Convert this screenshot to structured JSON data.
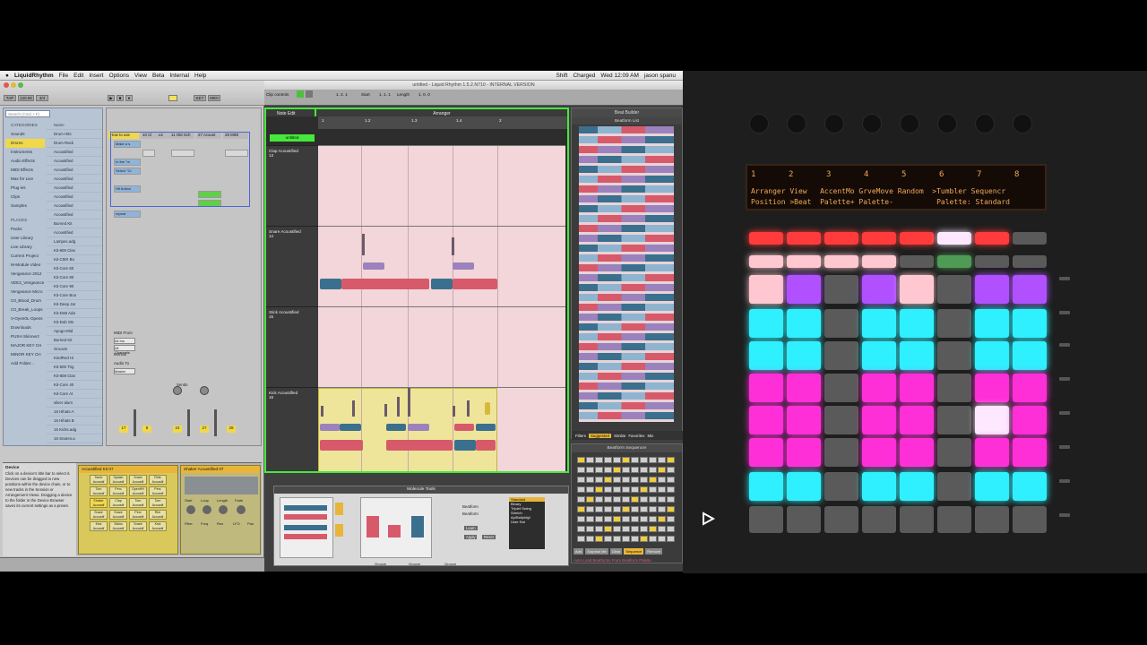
{
  "menubar": {
    "app_name": "LiquidRhythm",
    "items": [
      "File",
      "Edit",
      "Insert",
      "Options",
      "View",
      "Beta",
      "Internal",
      "Help"
    ],
    "right": [
      "Shift",
      "Charged",
      "Wed 12:09 AM",
      "jason spanu"
    ]
  },
  "live": {
    "browser": {
      "search_placeholder": "Search (Cmd + F)",
      "categories_label": "CATEGORIES",
      "name_label": "Name",
      "places_label": "PLACES",
      "categories": [
        "Sounds",
        "Drums",
        "Instruments",
        "Audio Effects",
        "MIDI Effects",
        "Max for Live",
        "Plug-ins",
        "Clips",
        "Samples"
      ],
      "places": [
        "Packs",
        "User Library",
        "Live Library",
        "Current Project",
        "M-Module Video",
        "Vengeance 2012",
        "VEE2_Vengeance",
        "Vengeance Micro",
        "C0_Blood_Drum",
        "C0_Break_Loops",
        "V-Oyen0L-Opens",
        "Downloads",
        "PUSH Skinnerz",
        "MAJOR KEY CH",
        "MINOR KEY CH",
        "Add Folder..."
      ],
      "files": [
        "Drum Hits",
        "Drum Rack",
        "Acoustified",
        "Acoustified",
        "Acoustified",
        "Acoustified",
        "Acoustified",
        "Acoustified",
        "Acoustified",
        "Acoustified",
        "Burned Kit",
        "Acoustified",
        "Lampex.adg",
        "Kit-606 Clas",
        "Kit-CMX Bo",
        "Kit-Core 60",
        "Kit-Core 80",
        "Kit-Core 90",
        "Kit-Core Boo",
        "Kit-Deep Jar",
        "Kit-DnB Ada",
        "Kit-Dub Ste",
        "Apogo-Mid",
        "Burned Kit",
        "Groovin",
        "KindRed Hi",
        "Kit-505 Trig",
        "Kit-808 Clas",
        "Kit-Core 40",
        "Kit-Core At",
        "silver alum",
        "16 Hihats A",
        "16 Hihats B",
        "16 Kicks.adg",
        "16 Snares.a"
      ]
    },
    "session": {
      "tracks": [
        "How to use",
        "10 Cl",
        "Lit",
        "11 Old Sch",
        "27 Acoust",
        "28 MIDI"
      ],
      "clips": [
        "Make a s",
        "In the \"m",
        "Select \"Cr",
        "Hit button",
        "repeat"
      ],
      "midi_from": "MIDI From",
      "all_ins": "All Ins",
      "all_channels": "All Channels",
      "monitor": "Monitor",
      "audio_to": "Audio To",
      "master": "Master",
      "sends": "Sends",
      "track_numbers": [
        "17",
        "8",
        "24",
        "27",
        "28"
      ]
    },
    "device": {
      "info_title": "Device",
      "info_text": "Click on a device's title bar to select it. Devices can be dragged to new positions within the device chain, or to new tracks in the Session or Arrangement Views. Dragging a device to the folder in the Device Browser saves its current settings as a preset.",
      "kit_title": "Acoustified Kit 07",
      "kit_pads": [
        "Tamb Acoustif",
        "Splash Acoustif",
        "Snare Acoustif",
        "Ride Acoustif",
        "Tom Acoustif",
        "Perc Acoustif",
        "OpenHH Acoustif",
        "Perc Acoustif",
        "Shaker Acoustif",
        "Clap Acoustif",
        "Tom Acoustif",
        "Tom Acoustif",
        "Snare Acoustif",
        "Snare Acoustif",
        "Perc Acoustif",
        "Rim Acoustif",
        "Kick Acoustif",
        "Sticks Acoustif",
        "Snare Acoustif",
        "Kick Acoustif"
      ],
      "shaker_title": "Shaker Acoustified 07",
      "shaker_params": [
        "Start",
        "Loop",
        "Length",
        "Fade",
        "Filter",
        "Freq",
        "Res",
        "LFO",
        "Pan"
      ]
    }
  },
  "lr": {
    "title": "untitled - Liquid Rhythm 1.5.2.N710 - INTERNAL VERSION",
    "toolbar": {
      "clip_controls": "Clip controls",
      "start": "Start",
      "position": "1. 2. 1",
      "length_label": "Length",
      "start_value": "1. 1. 1",
      "length_value": "1. 0. 0"
    },
    "note_edit": "Note Edit",
    "arranger": "Arranger",
    "clip_name": "untitled",
    "ruler_ticks": [
      "1",
      "1.2",
      "1.3",
      "1.4",
      "2"
    ],
    "lanes": [
      {
        "name": "Clap Acoustified",
        "num": "13"
      },
      {
        "name": "Snare Acoustified",
        "num": "14"
      },
      {
        "name": "Stick Acoustified",
        "num": "15"
      },
      {
        "name": "Kick Acoustified",
        "num": "16"
      }
    ],
    "beat_builder": "Beat Builder",
    "beatform_list": "Beatform List",
    "bf_tabs": [
      "Filters",
      "Suggested",
      "Similar",
      "Favorites",
      "Mix"
    ],
    "beatform_sequencer": "Beatform Sequencer",
    "seq_buttons": [
      "Add",
      "Surprise Me",
      "Clear",
      "Sequence",
      "Remove"
    ],
    "autoload": "Auto-Load Beatforms From Beatform Palette",
    "molecule_tools": "Molecule Tools",
    "mol_labels": [
      "Beatform",
      "Variation",
      "Accent",
      "Groove",
      "Rotate",
      "Learn",
      "Apply",
      "Reset",
      "Combs",
      "Groove",
      "Groove"
    ],
    "mol_options": [
      "Beatform",
      "Beatform"
    ],
    "mol_menu": [
      "Standard",
      "Binary",
      "Triplet Swing",
      "Stretch",
      "Ap/Ballphfgf",
      "User Swi"
    ]
  },
  "push": {
    "lcd_numbers": [
      "1",
      "2",
      "3",
      "4",
      "5",
      "6",
      "7",
      "8"
    ],
    "lcd_line1": "Arranger View   AccentMo GrveMove Random  >Tumbler Sequencr",
    "lcd_line2": "Position >Beat  Palette+ Palette-          Palette: Standard",
    "colors": {
      "red": "#ff3b3b",
      "pink": "#ffc8d0",
      "violet": "#b050ff",
      "cyan": "#2ff0ff",
      "magenta": "#ff2fd8",
      "grey": "#5a5a5a",
      "green": "#4f9a55",
      "white": "#fde8ff"
    },
    "grid": [
      [
        "red",
        "red",
        "red",
        "red",
        "red",
        "white",
        "red",
        "grey"
      ],
      [
        "pink",
        "pink",
        "pink",
        "pink",
        "grey",
        "green",
        "grey",
        "grey"
      ],
      [
        "pink",
        "violet",
        "grey",
        "violet",
        "pink",
        "grey",
        "violet",
        "violet"
      ],
      [
        "cyan",
        "cyan",
        "grey",
        "cyan",
        "cyan",
        "grey",
        "cyan",
        "cyan"
      ],
      [
        "cyan",
        "cyan",
        "grey",
        "cyan",
        "cyan",
        "grey",
        "cyan",
        "cyan"
      ],
      [
        "magenta",
        "magenta",
        "grey",
        "magenta",
        "magenta",
        "grey",
        "magenta",
        "magenta"
      ],
      [
        "magenta",
        "magenta",
        "grey",
        "magenta",
        "magenta",
        "grey",
        "white",
        "magenta"
      ],
      [
        "magenta",
        "magenta",
        "grey",
        "magenta",
        "magenta",
        "grey",
        "magenta",
        "magenta"
      ],
      [
        "cyan",
        "cyan",
        "grey",
        "cyan",
        "cyan",
        "grey",
        "cyan",
        "cyan"
      ],
      [
        "grey",
        "grey",
        "grey",
        "grey",
        "grey",
        "grey",
        "grey",
        "grey"
      ]
    ]
  }
}
